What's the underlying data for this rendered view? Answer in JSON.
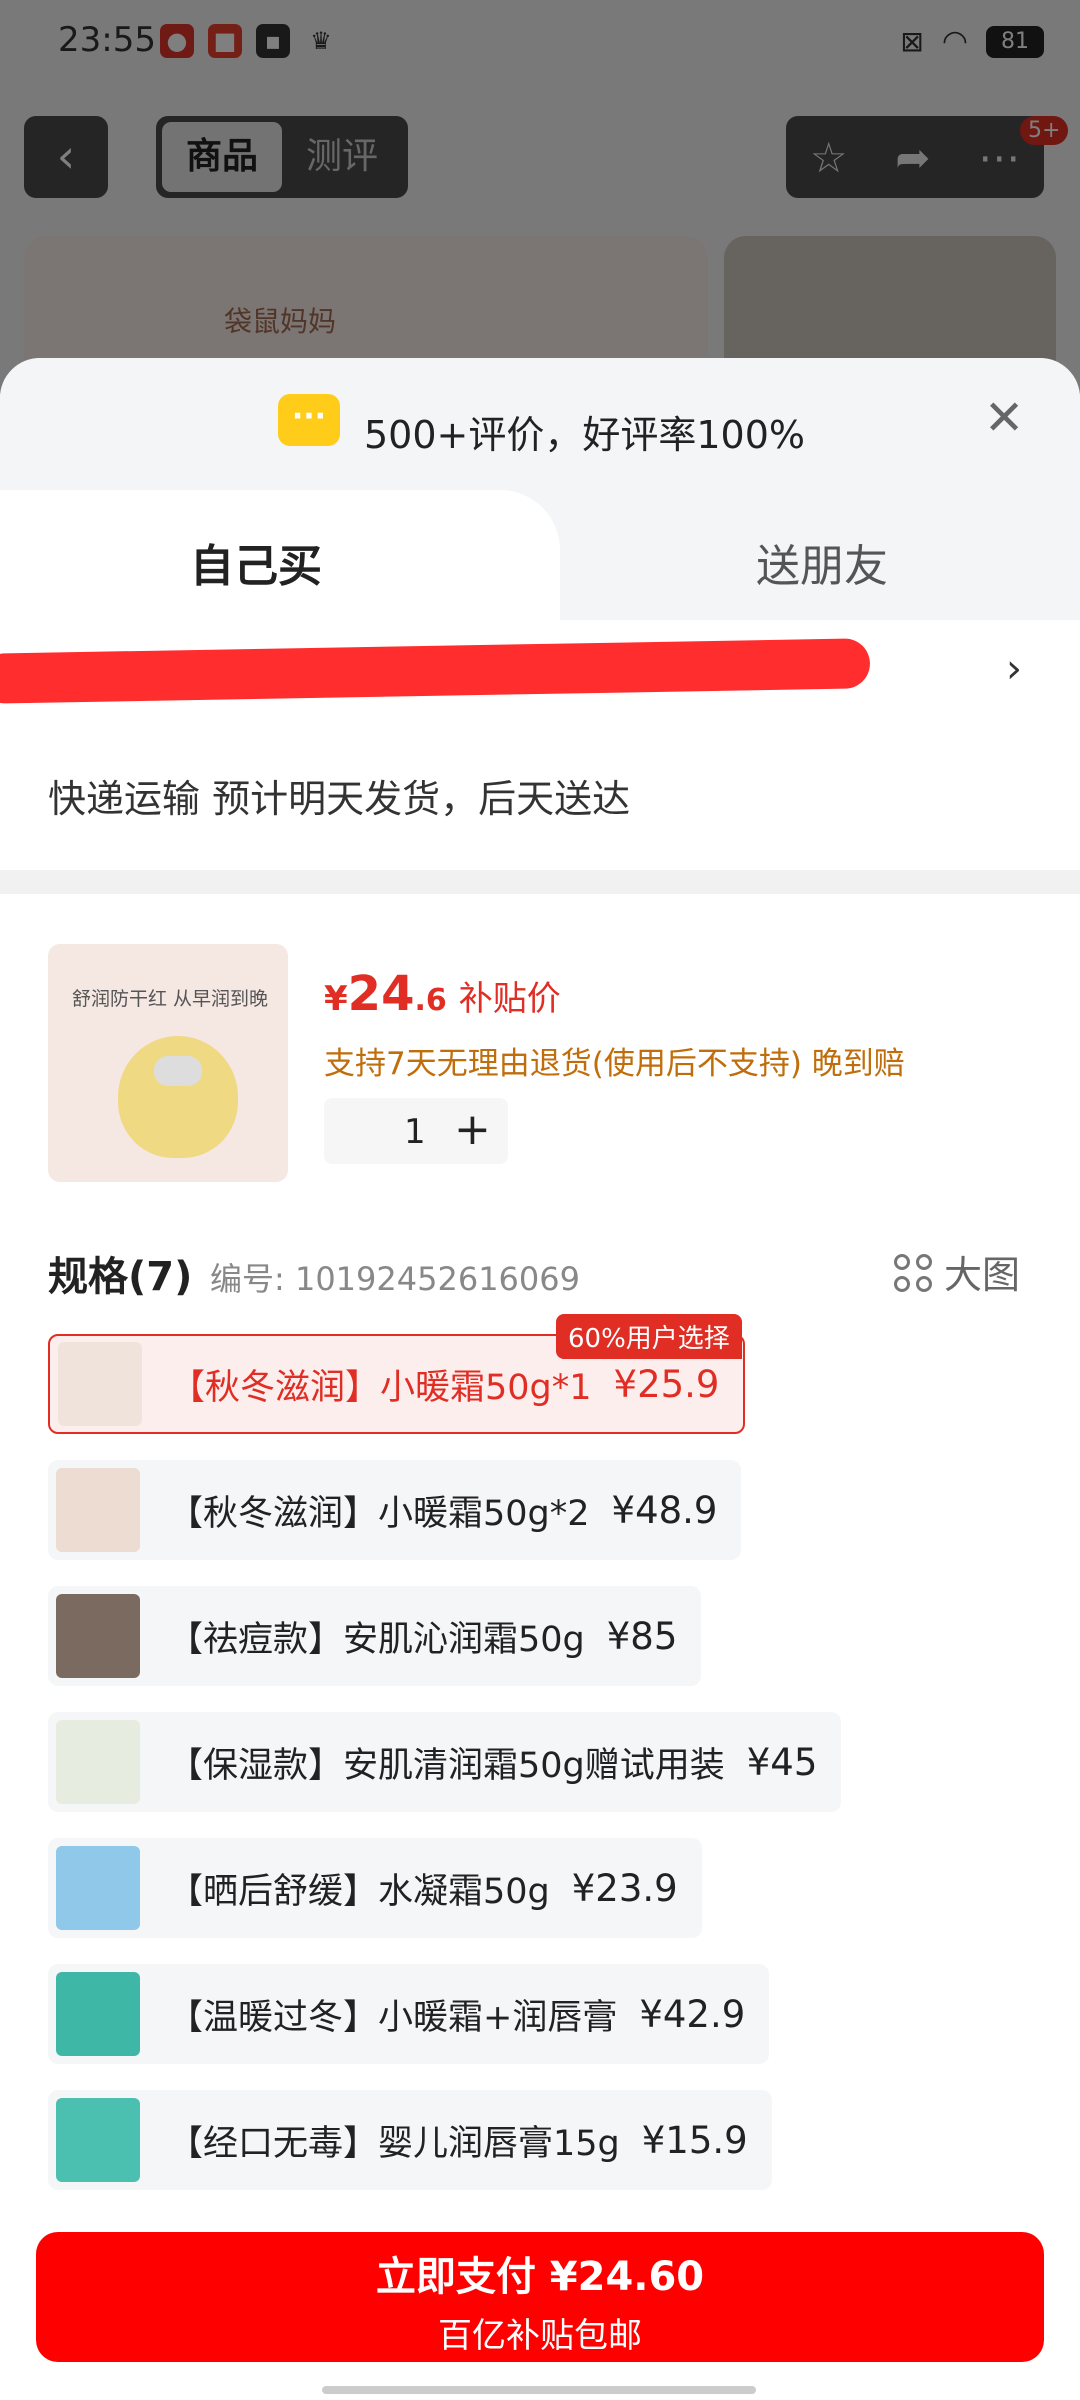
{
  "status_bar": {
    "time": "23:55",
    "battery": "81"
  },
  "nav": {
    "back_icon": "back-icon",
    "tabs": [
      "商品",
      "测评"
    ],
    "badge": "5+"
  },
  "bg_card": {
    "brand": "袋鼠妈妈"
  },
  "sheet": {
    "review_summary": "500+评价，好评率100%",
    "buy_tabs": [
      "自己买",
      "送朋友"
    ],
    "shipping": "快递运输 预计明天发货，后天送达"
  },
  "product": {
    "thumb_caption": "舒润防干红 从早润到晚",
    "price_symbol": "¥",
    "price_int": "24",
    "price_dec": ".6",
    "price_tag": "补贴价",
    "return_policy": "支持7天无理由退货(使用后不支持) 晚到赔",
    "qty": "1",
    "qty_plus": "+"
  },
  "spec": {
    "title": "规格(7)",
    "code": "编号: 10192452616069",
    "big_pic": "大图",
    "popular_badge": "60%用户选择",
    "items": [
      {
        "label": "【秋冬滋润】小暖霜50g*1",
        "price": "¥25.9"
      },
      {
        "label": "【秋冬滋润】小暖霜50g*2",
        "price": "¥48.9"
      },
      {
        "label": "【祛痘款】安肌沁润霜50g",
        "price": "¥85"
      },
      {
        "label": "【保湿款】安肌清润霜50g赠试用装",
        "price": "¥45"
      },
      {
        "label": "【晒后舒缓】水凝霜50g",
        "price": "¥23.9"
      },
      {
        "label": "【温暖过冬】小暖霜+润唇膏",
        "price": "¥42.9"
      },
      {
        "label": "【经口无毒】婴儿润唇膏15g",
        "price": "¥15.9"
      }
    ]
  },
  "pay": {
    "main": "立即支付 ¥24.60",
    "sub": "百亿补贴包邮"
  },
  "colors": {
    "accent_red": "#e02e24",
    "pay_red": "#ff0000",
    "return_orange": "#c06d0b"
  }
}
